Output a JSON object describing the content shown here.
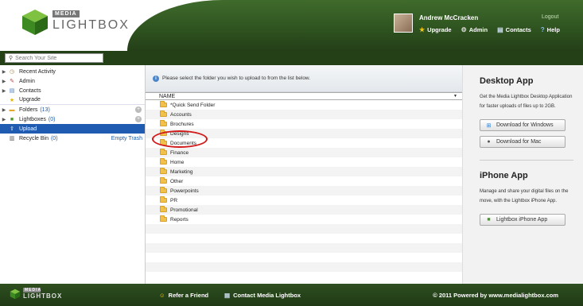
{
  "header": {
    "logo_media": "MEDIA",
    "logo_lightbox": "LIGHTBOX",
    "user_name": "Andrew McCracken",
    "logout_label": "Logout",
    "nav": [
      {
        "label": "Upgrade",
        "icon": "star-icon"
      },
      {
        "label": "Admin",
        "icon": "gear-icon"
      },
      {
        "label": "Contacts",
        "icon": "contacts-icon"
      },
      {
        "label": "Help",
        "icon": "help-icon"
      }
    ]
  },
  "search": {
    "placeholder": "Search Your Site"
  },
  "sidebar": {
    "items": [
      {
        "label": "Recent Activity",
        "icon": "clock-icon"
      },
      {
        "label": "Admin",
        "icon": "tools-icon"
      },
      {
        "label": "Contacts",
        "icon": "contacts-icon"
      },
      {
        "label": "Upgrade",
        "icon": "star-icon"
      },
      {
        "label": "Folders",
        "count": "(13)",
        "icon": "folder-icon"
      },
      {
        "label": "Lightboxes",
        "count": "(0)",
        "icon": "lightbox-icon"
      },
      {
        "label": "Upload",
        "icon": "upload-icon"
      },
      {
        "label": "Recycle Bin",
        "count": "(0)",
        "icon": "trash-icon",
        "action": "Empty Trash"
      }
    ]
  },
  "main": {
    "instruction": "Please select the folder you wish to upload to from the list below.",
    "column_name": "NAME",
    "folders": [
      "*Quick Send Folder",
      "Accounts",
      "Brochures",
      "Designs",
      "Documents",
      "Finance",
      "Home",
      "Marketing",
      "Other",
      "Powerpoints",
      "PR",
      "Promotional",
      "Reports"
    ],
    "highlighted_folder": "Designs"
  },
  "right_panel": {
    "desktop_title": "Desktop App",
    "desktop_text": "Get the Media Lightbox Desktop Application for faster uploads of files up to 2GB.",
    "download_windows": "Download for Windows",
    "download_mac": "Download for Mac",
    "iphone_title": "iPhone App",
    "iphone_text": "Manage and share your digital files on the move, with the Lightbox iPhone App.",
    "iphone_button": "Lightbox iPhone App"
  },
  "footer": {
    "logo_media": "MEDIA",
    "logo_lightbox": "LIGHTBOX",
    "refer_label": "Refer a Friend",
    "contact_label": "Contact Media Lightbox",
    "copyright": "© 2011 Powered by www.medialightbox.com"
  },
  "colors": {
    "header_green": "#2f5420",
    "active_blue": "#1f5bb0",
    "link_blue": "#1a5aa8",
    "highlight_red": "#d11a1a"
  }
}
